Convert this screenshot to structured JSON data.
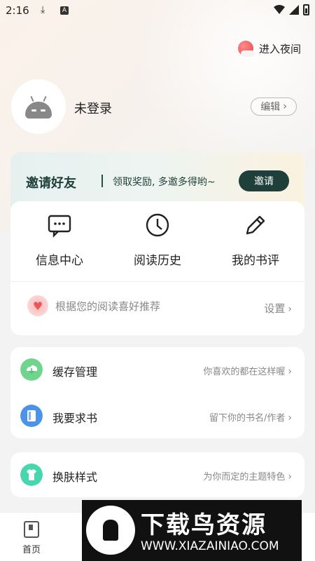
{
  "status_bar": {
    "time": "2:16",
    "download_icon": "download-icon",
    "notification_icon": "a-icon",
    "a_letter": "A"
  },
  "night_mode": {
    "label": "进入夜间",
    "icon": "moon-cloud-icon"
  },
  "profile": {
    "name": "未登录",
    "edit_label": "编辑",
    "avatar_icon": "android-icon"
  },
  "invite": {
    "title": "邀请好友",
    "desc": "领取奖励, 多邀多得哟~",
    "button": "邀请"
  },
  "quick_actions": [
    {
      "label": "信息中心",
      "icon": "message-icon"
    },
    {
      "label": "阅读历史",
      "icon": "clock-icon"
    },
    {
      "label": "我的书评",
      "icon": "pencil-icon"
    }
  ],
  "recommend": {
    "text": "根据您的阅读喜好推荐",
    "settings": "设置"
  },
  "list_rows": [
    {
      "name": "缓存管理",
      "hint": "你喜欢的都在这样喔",
      "icon": "download-cloud-icon",
      "color": "#4fcf7f"
    },
    {
      "name": "我要求书",
      "hint": "留下你的书名/作者",
      "icon": "book-request-icon",
      "color": "#3f8fe8"
    }
  ],
  "skin_row": {
    "name": "换肤样式",
    "hint": "为你而定的主题特色",
    "icon": "shirt-icon",
    "color": "#3fd3a6"
  },
  "bottom_nav": {
    "home_label": "首页"
  },
  "watermark": {
    "title": "下载鸟资源",
    "url": "WWW.XIAZAINIAO.COM"
  }
}
